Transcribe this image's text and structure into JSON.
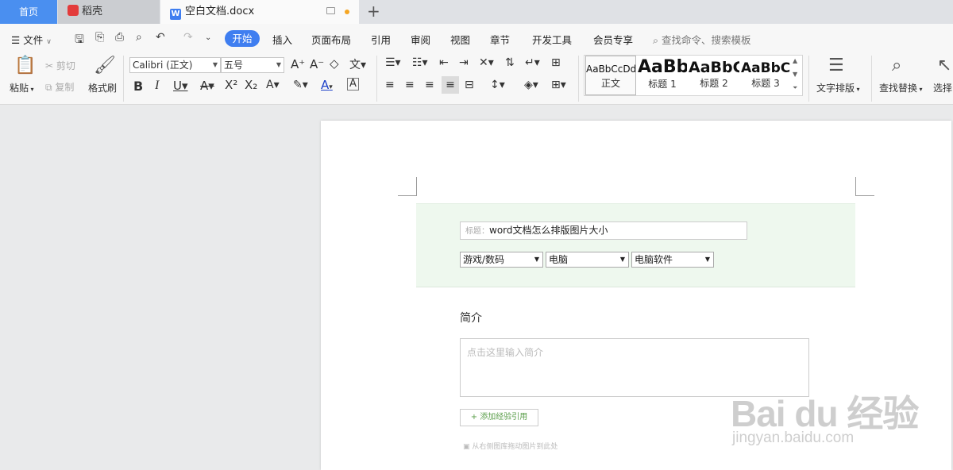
{
  "tabs": {
    "home": "首页",
    "daoke": "稻壳",
    "doc": "空白文档.docx"
  },
  "menu": {
    "file": "文件",
    "items": [
      "开始",
      "插入",
      "页面布局",
      "引用",
      "审阅",
      "视图",
      "章节",
      "开发工具",
      "会员专享"
    ],
    "search_placeholder": "查找命令、搜索模板"
  },
  "ribbon": {
    "paste": "粘贴",
    "cut": "剪切",
    "copy": "复制",
    "format_painter": "格式刷",
    "font": "Calibri (正文)",
    "size": "五号",
    "styles": [
      {
        "preview": "AaBbCcDd",
        "name": "正文"
      },
      {
        "preview": "AaBb",
        "name": "标题 1"
      },
      {
        "preview": "AaBbC",
        "name": "标题 2"
      },
      {
        "preview": "AaBbC",
        "name": "标题 3"
      }
    ],
    "text_layout": "文字排版",
    "find_replace": "查找替换",
    "select": "选择"
  },
  "form": {
    "title_label": "标题：",
    "title_value": "word文档怎么排版图片大小",
    "category1": "游戏/数码",
    "category2": "电脑",
    "category3": "电脑软件",
    "intro_label": "简介",
    "intro_placeholder": "点击这里输入简介",
    "add_ref": "+ 添加经验引用",
    "drag_hint": "从右侧图库拖动图片到此处"
  },
  "watermark": {
    "logo": "Bai du 经验",
    "url": "jingyan.baidu.com"
  },
  "colors": {
    "accent": "#3f7ef0",
    "panel_green": "#eef8ee"
  }
}
